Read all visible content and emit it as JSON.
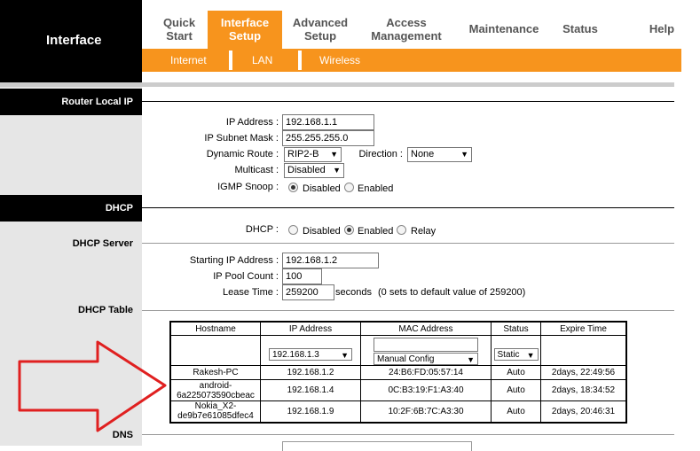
{
  "brand": {
    "title": "Interface"
  },
  "nav": {
    "tabs": [
      {
        "l1": "Quick",
        "l2": "Start"
      },
      {
        "l1": "Interface",
        "l2": "Setup"
      },
      {
        "l1": "Advanced",
        "l2": "Setup"
      },
      {
        "l1": "Access",
        "l2": "Management"
      },
      {
        "l1": "Maintenance",
        "l2": ""
      },
      {
        "l1": "Status",
        "l2": ""
      },
      {
        "l1": "Help",
        "l2": ""
      }
    ],
    "subtabs": [
      "Internet",
      "LAN",
      "Wireless"
    ]
  },
  "sections": {
    "router_local_ip": "Router Local IP",
    "dhcp": "DHCP",
    "dhcp_server": "DHCP Server",
    "dhcp_table": "DHCP Table",
    "dns": "DNS"
  },
  "router": {
    "ip_label": "IP Address :",
    "ip_value": "192.168.1.1",
    "mask_label": "IP Subnet Mask :",
    "mask_value": "255.255.255.0",
    "route_label": "Dynamic Route :",
    "route_value": "RIP2-B",
    "direction_label": "Direction :",
    "direction_value": "None",
    "multicast_label": "Multicast :",
    "multicast_value": "Disabled",
    "igmp_label": "IGMP Snoop :",
    "igmp_opt1": "Disabled",
    "igmp_opt2": "Enabled"
  },
  "dhcp": {
    "label": "DHCP :",
    "opt1": "Disabled",
    "opt2": "Enabled",
    "opt3": "Relay",
    "start_label": "Starting IP Address :",
    "start_value": "192.168.1.2",
    "pool_label": "IP Pool Count :",
    "pool_value": "100",
    "lease_label": "Lease Time :",
    "lease_value": "259200",
    "lease_unit": "seconds",
    "lease_note": "(0 sets to default value of 259200)"
  },
  "table": {
    "headers": [
      "Hostname",
      "IP Address",
      "MAC Address",
      "Status",
      "Expire Time"
    ],
    "entry": {
      "ip_select": "192.168.1.3",
      "mac_mode": "Manual Config",
      "status_select": "Static"
    },
    "rows": [
      {
        "host1": "Rakesh-PC",
        "host2": "",
        "ip": "192.168.1.2",
        "mac": "24:B6:FD:05:57:14",
        "status": "Auto",
        "expire": "2days, 22:49:56"
      },
      {
        "host1": "android-",
        "host2": "6a225073590cbeac",
        "ip": "192.168.1.4",
        "mac": "0C:B3:19:F1:A3:40",
        "status": "Auto",
        "expire": "2days, 18:34:52"
      },
      {
        "host1": "Nokia_X2-",
        "host2": "de9b7e61085dfec4",
        "ip": "192.168.1.9",
        "mac": "10:2F:6B:7C:A3:30",
        "status": "Auto",
        "expire": "2days, 20:46:31"
      }
    ]
  },
  "colors": {
    "accent": "#f7941d",
    "arrow": "#e02020"
  }
}
